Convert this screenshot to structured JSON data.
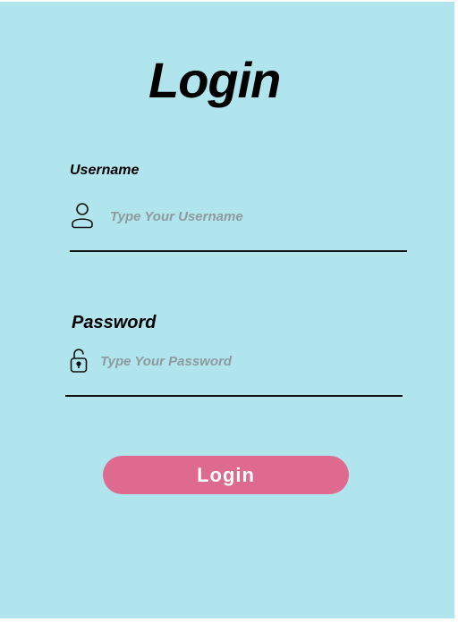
{
  "form": {
    "title": "Login",
    "username": {
      "label": "Username",
      "placeholder": "Type Your Username",
      "value": "",
      "icon": "user-icon"
    },
    "password": {
      "label": "Password",
      "placeholder": "Type Your Password",
      "value": "",
      "icon": "lock-icon"
    },
    "submit_label": "Login"
  },
  "colors": {
    "background": "#b0e5ee",
    "button": "#df6a8f",
    "button_text": "#ffffff",
    "placeholder": "#8e9aa0",
    "text": "#000000"
  }
}
